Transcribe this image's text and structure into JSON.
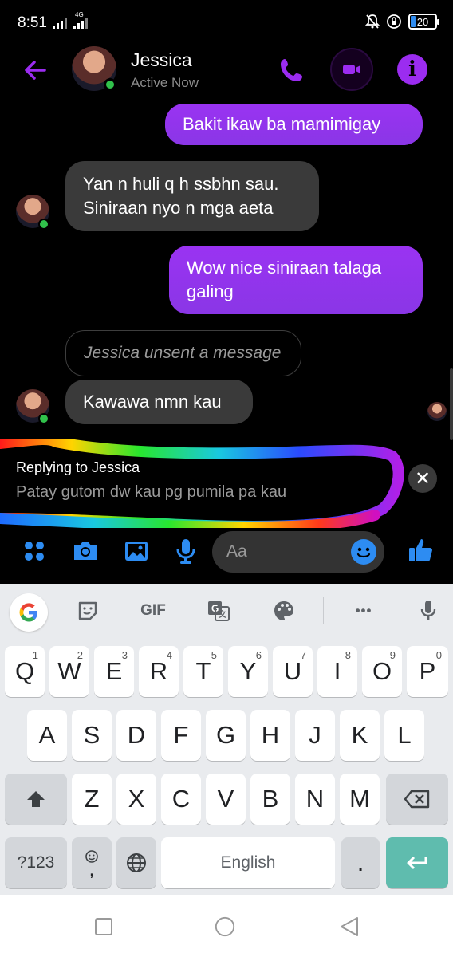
{
  "status_bar": {
    "time": "8:51",
    "network": "4G",
    "battery": "20"
  },
  "header": {
    "contact_name": "Jessica",
    "contact_status": "Active Now",
    "back_icon": "back-arrow-icon",
    "call_icon": "phone-icon",
    "video_icon": "video-camera-icon",
    "info_icon": "info-icon"
  },
  "messages": [
    {
      "side": "out",
      "text": "Bakit ikaw ba mamimigay"
    },
    {
      "side": "in",
      "lines": [
        "Yan n huli q h ssbhn sau.",
        "Siniraan nyo n mga aeta"
      ]
    },
    {
      "side": "out",
      "lines": [
        "Wow nice siniraan talaga",
        "galing"
      ]
    },
    {
      "side": "in",
      "text": "Jessica unsent a message",
      "unsent": true
    },
    {
      "side": "in",
      "text": "Kawawa nmn kau"
    }
  ],
  "reply": {
    "title": "Replying to Jessica",
    "quoted": "Patay gutom dw kau pg pumila pa kau",
    "close_symbol": "✕"
  },
  "composer": {
    "placeholder": "Aa",
    "icons": [
      "more-apps-icon",
      "camera-icon",
      "gallery-icon",
      "microphone-icon",
      "emoji-icon",
      "thumbs-up-icon"
    ]
  },
  "keyboard": {
    "toolbar": {
      "gif_label": "GIF",
      "more_symbol": "•••"
    },
    "row1": [
      {
        "key": "Q",
        "hint": "1"
      },
      {
        "key": "W",
        "hint": "2"
      },
      {
        "key": "E",
        "hint": "3"
      },
      {
        "key": "R",
        "hint": "4"
      },
      {
        "key": "T",
        "hint": "5"
      },
      {
        "key": "Y",
        "hint": "6"
      },
      {
        "key": "U",
        "hint": "7"
      },
      {
        "key": "I",
        "hint": "8"
      },
      {
        "key": "O",
        "hint": "9"
      },
      {
        "key": "P",
        "hint": "0"
      }
    ],
    "row2": [
      "A",
      "S",
      "D",
      "F",
      "G",
      "H",
      "J",
      "K",
      "L"
    ],
    "row3": [
      "Z",
      "X",
      "C",
      "V",
      "B",
      "N",
      "M"
    ],
    "symbols_label": "?123",
    "comma_label": ",",
    "space_label": "English",
    "period_label": "."
  },
  "colors": {
    "accent": "#9b2cf0",
    "online": "#31c14b",
    "enter_key": "#5fbcae"
  }
}
